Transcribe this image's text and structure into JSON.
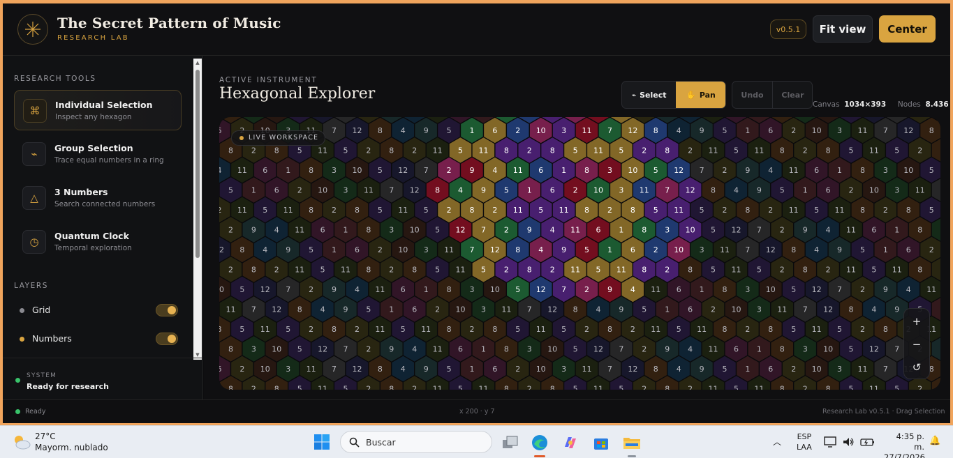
{
  "header": {
    "title": "The Secret Pattern of Music",
    "subtitle": "RESEARCH LAB",
    "version": "v0.5.1",
    "fit_view": "Fit view",
    "center": "Center"
  },
  "sidebar": {
    "tools_title": "RESEARCH TOOLS",
    "tools": [
      {
        "icon": "command-icon",
        "glyph": "⌘",
        "name": "Individual Selection",
        "desc": "Inspect any hexagon",
        "active": true
      },
      {
        "icon": "lasso-icon",
        "glyph": "⌁",
        "name": "Group Selection",
        "desc": "Trace equal numbers in a ring",
        "active": false
      },
      {
        "icon": "triangle-icon",
        "glyph": "△",
        "name": "3 Numbers",
        "desc": "Search connected numbers",
        "active": false
      },
      {
        "icon": "clock-icon",
        "glyph": "◷",
        "name": "Quantum Clock",
        "desc": "Temporal exploration",
        "active": false
      }
    ],
    "layers_title": "LAYERS",
    "layers": [
      {
        "label": "Grid",
        "dot": "#8a8a90",
        "on": true
      },
      {
        "label": "Numbers",
        "dot": "#d9a440",
        "on": true
      }
    ],
    "system_label": "SYSTEM",
    "system_status": "Ready for research"
  },
  "main": {
    "instrument_label": "ACTIVE INSTRUMENT",
    "instrument_title": "Hexagonal Explorer",
    "select": "Select",
    "pan": "Pan",
    "undo": "Undo",
    "clear": "Clear",
    "canvas_label": "Canvas",
    "canvas_value": "1034×393",
    "nodes_label": "Nodes",
    "nodes_value": "8.436",
    "workspace_badge": "LIVE WORKSPACE",
    "zoom_in": "+",
    "zoom_out": "−",
    "reset": "↺"
  },
  "statusbar": {
    "ready": "Ready",
    "coords": "x 200 · y 7",
    "right": "Research Lab v0.5.1 · Drag Selection"
  },
  "colors": {
    "accent": "#d9a440",
    "bg": "#0d0d0f",
    "hex_palette": [
      "#3a1c1f",
      "#2e2a12",
      "#16301a",
      "#11283a",
      "#24193a",
      "#38182c",
      "#2b2b2b",
      "#3a2410",
      "#1a2e2e",
      "#2c1a12",
      "#1e2410",
      "#1a1a30"
    ],
    "highlight": [
      "#c8102e",
      "#e3b33d",
      "#2a9a4f",
      "#2f5fbf",
      "#7a2fbf",
      "#cf2f7f"
    ]
  },
  "taskbar": {
    "temp": "27°C",
    "weather": "Mayorm. nublado",
    "search": "Buscar",
    "lang_top": "ESP",
    "lang_bottom": "LAA",
    "time": "4:35 p. m.",
    "date": "27/7/2026"
  }
}
